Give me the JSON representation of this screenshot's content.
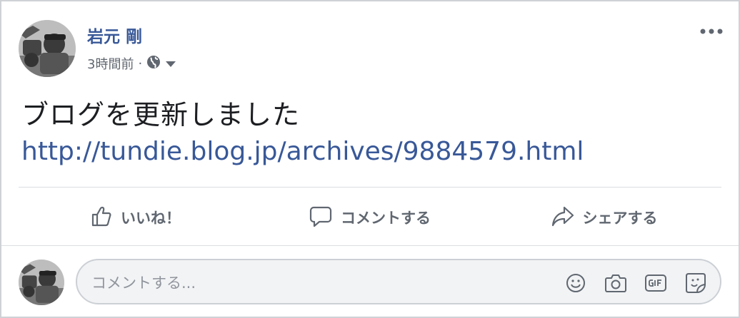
{
  "post": {
    "author": "岩元 剛",
    "time": "3時間前",
    "separator": "·",
    "text": "ブログを更新しました",
    "link": "http://tundie.blog.jp/archives/9884579.html"
  },
  "actions": {
    "like": "いいね！",
    "comment": "コメントする",
    "share": "シェアする"
  },
  "comment_box": {
    "placeholder": "コメントする..."
  },
  "icons": {
    "avatar": "avatar",
    "privacy": "globe-icon",
    "menu": "more-options-icon",
    "like": "thumbs-up-icon",
    "comment": "comment-bubble-icon",
    "share": "share-arrow-icon",
    "emoji": "emoji-icon",
    "photo": "camera-icon",
    "gif": "gif-icon",
    "sticker": "sticker-icon"
  },
  "colors": {
    "author": "#385898",
    "link": "#385898",
    "muted": "#606770"
  }
}
